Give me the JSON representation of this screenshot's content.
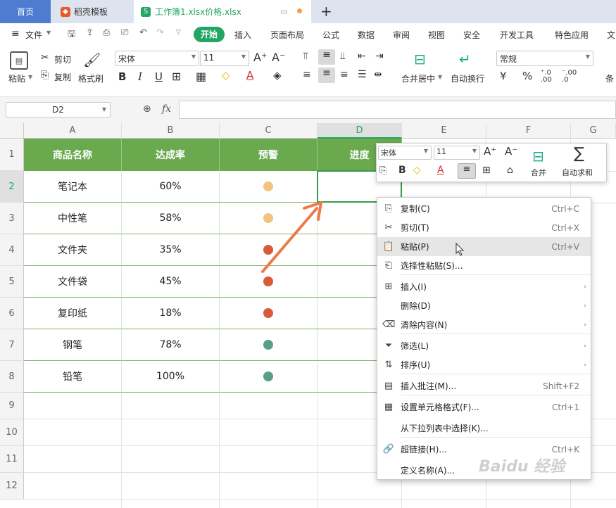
{
  "tabs": {
    "home": "首页",
    "templates": "稻壳模板",
    "workbook": "工作簿1.xlsx价格.xlsx",
    "add": "+"
  },
  "menu": {
    "file": "文件",
    "start": "开始",
    "items": [
      "插入",
      "页面布局",
      "公式",
      "数据",
      "审阅",
      "视图",
      "安全",
      "开发工具",
      "特色应用",
      "文"
    ]
  },
  "ribbon": {
    "paste": "粘贴",
    "cut": "剪切",
    "copy": "复制",
    "format_painter": "格式刷",
    "font": "宋体",
    "size": "11",
    "merge": "合并居中",
    "wrap": "自动换行",
    "number_format": "常规",
    "font_increase": "A⁺",
    "font_decrease": "A⁻",
    "bold": "B",
    "italic": "I",
    "underline": "U",
    "percent": "%",
    "decimals_inc": "⁺.0 .00",
    "decimals_dec": "⁻.00 .0",
    "cond": "条"
  },
  "formula": {
    "cell_ref": "D2",
    "fx": "fx",
    "zoom_icon": "⊕"
  },
  "columns": [
    "A",
    "B",
    "C",
    "D",
    "E",
    "F",
    "G"
  ],
  "rows": [
    "1",
    "2",
    "3",
    "4",
    "5",
    "6",
    "7",
    "8",
    "9",
    "10",
    "11",
    "12"
  ],
  "headers": [
    "商品名称",
    "达成率",
    "预警",
    "进度"
  ],
  "data": [
    {
      "name": "笔记本",
      "rate": "60%",
      "color": "#f2c47e"
    },
    {
      "name": "中性笔",
      "rate": "58%",
      "color": "#f2c47e"
    },
    {
      "name": "文件夹",
      "rate": "35%",
      "color": "#d95a3a"
    },
    {
      "name": "文件袋",
      "rate": "45%",
      "color": "#d95a3a"
    },
    {
      "name": "复印纸",
      "rate": "18%",
      "color": "#d95a3a"
    },
    {
      "name": "钢笔",
      "rate": "78%",
      "color": "#5a9e8a"
    },
    {
      "name": "铅笔",
      "rate": "100%",
      "color": "#5a9e8a"
    }
  ],
  "minibar": {
    "font": "宋体",
    "size": "11",
    "merge": "合并",
    "autosum": "自动求和",
    "grow": "A⁺",
    "shrink": "A⁻",
    "bold": "B",
    "sigma": "∑"
  },
  "context_menu": [
    {
      "label": "复制(C)",
      "shortcut": "Ctrl+C",
      "icon": "copy-icon",
      "glyph": "⎘"
    },
    {
      "label": "剪切(T)",
      "shortcut": "Ctrl+X",
      "icon": "scissors-icon",
      "glyph": "✂"
    },
    {
      "label": "粘贴(P)",
      "shortcut": "Ctrl+V",
      "icon": "paste-icon",
      "glyph": "📋"
    },
    {
      "label": "选择性粘贴(S)...",
      "shortcut": "",
      "icon": "paste-special-icon",
      "glyph": "⎗"
    },
    {
      "label": "插入(I)",
      "shortcut": "",
      "icon": "insert-icon",
      "glyph": "⊞"
    },
    {
      "label": "删除(D)",
      "shortcut": "",
      "icon": "",
      "glyph": ""
    },
    {
      "label": "清除内容(N)",
      "shortcut": "",
      "icon": "eraser-icon",
      "glyph": "⌫"
    },
    {
      "label": "筛选(L)",
      "shortcut": "",
      "icon": "filter-icon",
      "glyph": "⏷"
    },
    {
      "label": "排序(U)",
      "shortcut": "",
      "icon": "sort-icon",
      "glyph": "⇅"
    },
    {
      "label": "插入批注(M)...",
      "shortcut": "Shift+F2",
      "icon": "comment-icon",
      "glyph": "▤"
    },
    {
      "label": "设置单元格格式(F)...",
      "shortcut": "Ctrl+1",
      "icon": "format-cells-icon",
      "glyph": "▦"
    },
    {
      "label": "从下拉列表中选择(K)...",
      "shortcut": "",
      "icon": "",
      "glyph": ""
    },
    {
      "label": "超链接(H)...",
      "shortcut": "Ctrl+K",
      "icon": "link-icon",
      "glyph": "🔗"
    },
    {
      "label": "定义名称(A)...",
      "shortcut": "",
      "icon": "",
      "glyph": ""
    }
  ],
  "submenu_arrow": "›",
  "colors": {
    "green": "#6aa94e",
    "accent_blue": "#4d7cd0",
    "arrow": "#ee7a4a"
  }
}
